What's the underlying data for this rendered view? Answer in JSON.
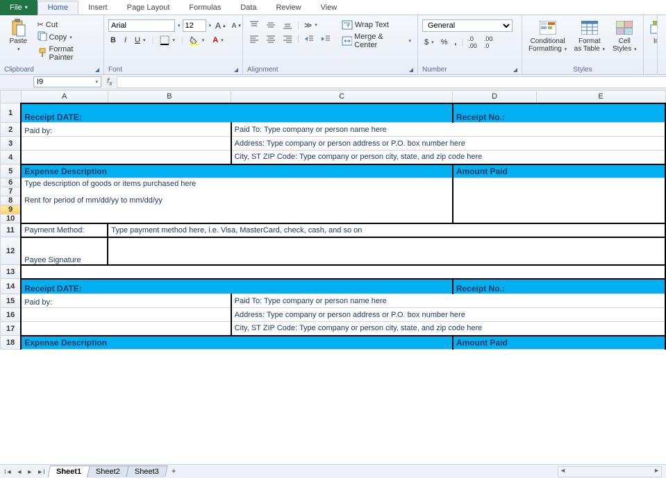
{
  "tabs": {
    "file": "File",
    "home": "Home",
    "insert": "Insert",
    "pageLayout": "Page Layout",
    "formulas": "Formulas",
    "data": "Data",
    "review": "Review",
    "view": "View"
  },
  "clipboard": {
    "paste": "Paste",
    "cut": "Cut",
    "copy": "Copy",
    "formatPainter": "Format Painter",
    "label": "Clipboard"
  },
  "font": {
    "name": "Arial",
    "size": "12",
    "label": "Font"
  },
  "alignment": {
    "wrap": "Wrap Text",
    "merge": "Merge & Center",
    "label": "Alignment"
  },
  "number": {
    "format": "General",
    "label": "Number"
  },
  "styles": {
    "cond": "Conditional Formatting",
    "condL1": "Conditional",
    "condL2": "Formatting",
    "table": "Format as Table",
    "tableL1": "Format",
    "tableL2": "as Table",
    "cell": "Cell Styles",
    "cellL1": "Cell",
    "cellL2": "Styles",
    "label": "Styles"
  },
  "insertTrunc": "In",
  "namebox": "I9",
  "sheets": {
    "s1": "Sheet1",
    "s2": "Sheet2",
    "s3": "Sheet3"
  },
  "cols": [
    "A",
    "B",
    "C",
    "D",
    "E"
  ],
  "cells": {
    "receiptDate": "Receipt DATE:",
    "receiptNo": "Receipt No.:",
    "paidBy": "Paid by:",
    "paidTo": "Paid To:   Type company or person name here",
    "address": "Address:  Type company or person address or P.O. box number here",
    "cityzip": "City, ST  ZIP Code:  Type company or person city, state, and zip code here",
    "expDesc": "Expense Description",
    "amtPaid": "Amount Paid",
    "descText": "Type description of goods or items purchased here",
    "rentText": "Rent for period of mm/dd/yy to mm/dd/yy",
    "payMethod": "Payment Method:",
    "payMethodHint": "Type payment method here, i.e. Visa, MasterCard, check, cash, and so on",
    "payeeSig": "Payee Signature"
  }
}
